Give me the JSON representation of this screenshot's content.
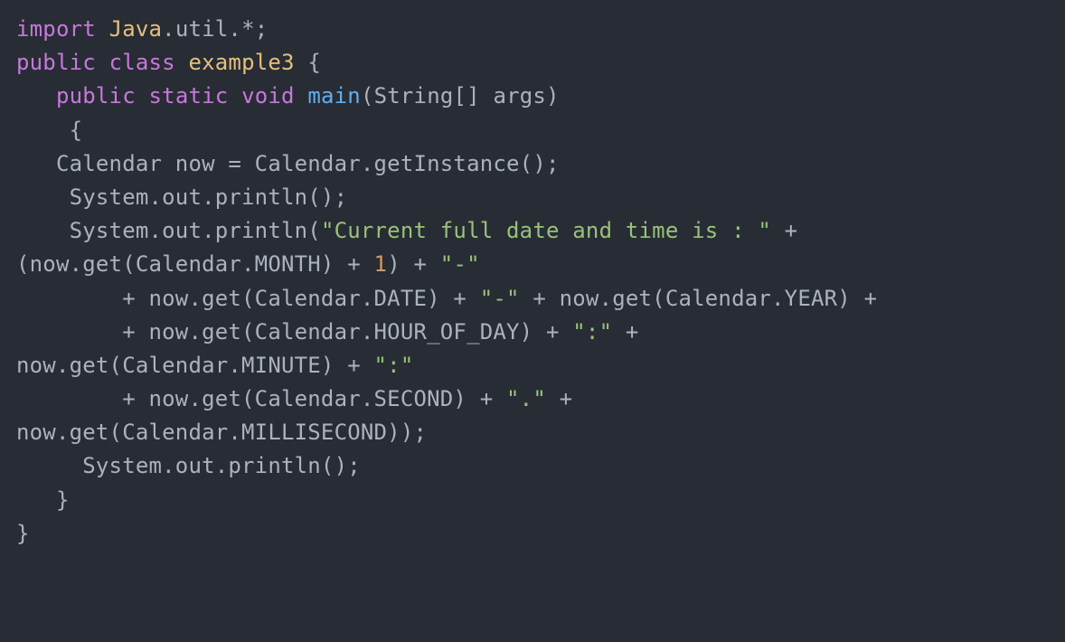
{
  "lines": [
    [
      {
        "t": "import",
        "c": "keyword"
      },
      {
        "t": " ",
        "c": "punct"
      },
      {
        "t": "Java",
        "c": "classname"
      },
      {
        "t": ".util.*;",
        "c": "ident"
      }
    ],
    [
      {
        "t": "public",
        "c": "keyword"
      },
      {
        "t": " ",
        "c": "punct"
      },
      {
        "t": "class",
        "c": "keyword"
      },
      {
        "t": " ",
        "c": "punct"
      },
      {
        "t": "example3",
        "c": "classname"
      },
      {
        "t": " {",
        "c": "punct"
      }
    ],
    [
      {
        "t": "   ",
        "c": "punct"
      },
      {
        "t": "public",
        "c": "keyword"
      },
      {
        "t": " ",
        "c": "punct"
      },
      {
        "t": "static",
        "c": "keyword"
      },
      {
        "t": " ",
        "c": "punct"
      },
      {
        "t": "void",
        "c": "keyword"
      },
      {
        "t": " ",
        "c": "punct"
      },
      {
        "t": "main",
        "c": "funcname"
      },
      {
        "t": "(String[] args)",
        "c": "ident"
      }
    ],
    [
      {
        "t": "    {",
        "c": "punct"
      }
    ],
    [
      {
        "t": "   Calendar now = Calendar.getInstance();",
        "c": "ident"
      }
    ],
    [
      {
        "t": "    System.out.println();",
        "c": "ident"
      }
    ],
    [
      {
        "t": "    System.out.println(",
        "c": "ident"
      },
      {
        "t": "\"Current full date and time is : \"",
        "c": "string"
      },
      {
        "t": " + ",
        "c": "ident"
      }
    ],
    [
      {
        "t": "(now.get(Calendar.MONTH) + ",
        "c": "ident"
      },
      {
        "t": "1",
        "c": "number"
      },
      {
        "t": ") + ",
        "c": "ident"
      },
      {
        "t": "\"-\"",
        "c": "string"
      }
    ],
    [
      {
        "t": "        + now.get(Calendar.DATE) + ",
        "c": "ident"
      },
      {
        "t": "\"-\"",
        "c": "string"
      },
      {
        "t": " + now.get(Calendar.YEAR) + ",
        "c": "ident"
      }
    ],
    [
      {
        "t": "        + now.get(Calendar.HOUR_OF_DAY) + ",
        "c": "ident"
      },
      {
        "t": "\":\"",
        "c": "string"
      },
      {
        "t": " + ",
        "c": "ident"
      }
    ],
    [
      {
        "t": "now.get(Calendar.MINUTE) + ",
        "c": "ident"
      },
      {
        "t": "\":\"",
        "c": "string"
      }
    ],
    [
      {
        "t": "        + now.get(Calendar.SECOND) + ",
        "c": "ident"
      },
      {
        "t": "\".\"",
        "c": "string"
      },
      {
        "t": " + ",
        "c": "ident"
      }
    ],
    [
      {
        "t": "now.get(Calendar.MILLISECOND));",
        "c": "ident"
      }
    ],
    [
      {
        "t": "     System.out.println();",
        "c": "ident"
      }
    ],
    [
      {
        "t": "   }",
        "c": "punct"
      }
    ],
    [
      {
        "t": "}",
        "c": "punct"
      }
    ]
  ]
}
